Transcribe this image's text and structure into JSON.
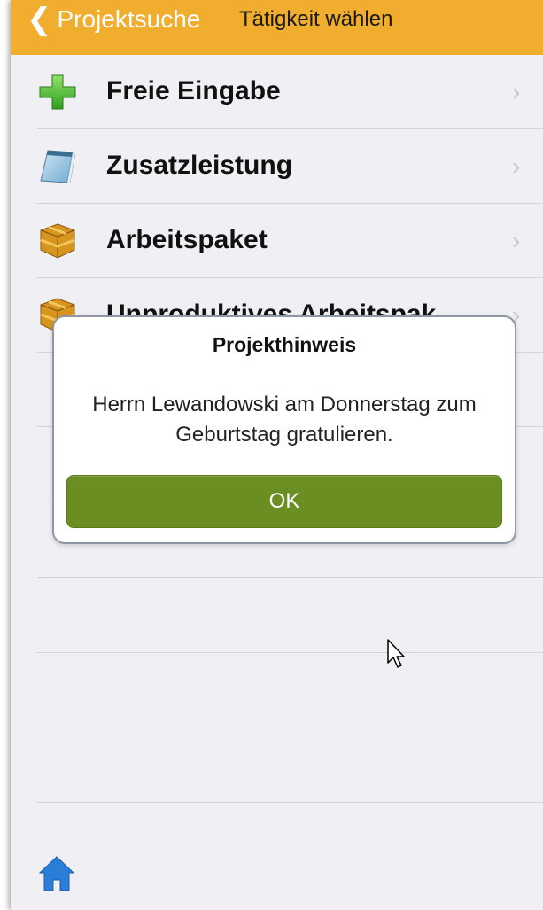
{
  "navbar": {
    "back_label": "Projektsuche",
    "title": "Tätigkeit wählen",
    "back_icon": "chevron-left-icon"
  },
  "list": {
    "items": [
      {
        "label": "Freie Eingabe",
        "icon": "plus-icon"
      },
      {
        "label": "Zusatzleistung",
        "icon": "notepad-icon"
      },
      {
        "label": "Arbeitspaket",
        "icon": "package-icon"
      },
      {
        "label": "Unproduktives Arbeitspak...",
        "icon": "package-icon"
      }
    ]
  },
  "dialog": {
    "title": "Projekthinweis",
    "message": "Herrn Lewandowski am Donnerstag zum Geburtstag gratulieren.",
    "ok_label": "OK"
  },
  "tabbar": {
    "home_icon": "home-icon"
  },
  "colors": {
    "navbar": "#f0ad2e",
    "ok_button": "#6b8e23",
    "background": "#efeff4",
    "home_icon": "#2a7ed8"
  }
}
